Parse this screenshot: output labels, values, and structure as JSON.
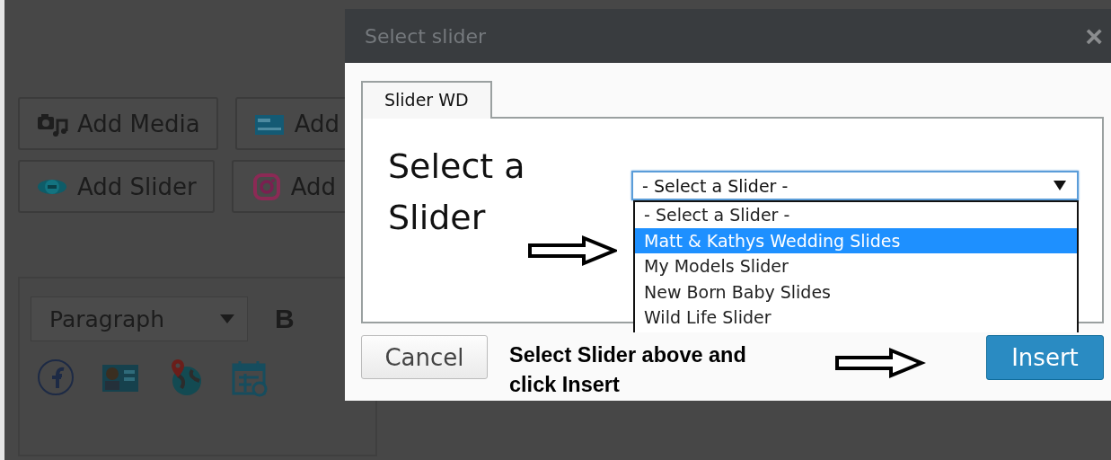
{
  "background": {
    "buttons": [
      {
        "label": "Add Media"
      },
      {
        "label": "Add"
      },
      {
        "label": "Add Slider"
      },
      {
        "label": "Add"
      }
    ],
    "editor": {
      "format": "Paragraph",
      "bold": "B"
    }
  },
  "dialog": {
    "title": "Select slider",
    "close": "×",
    "tabs": [
      {
        "label": "Slider WD",
        "selected": true
      }
    ],
    "heading": "Select a Slider",
    "select": {
      "value": "- Select a Slider -",
      "expanded": true,
      "options": [
        {
          "label": "- Select a Slider -",
          "highlighted": false
        },
        {
          "label": "Matt & Kathys Wedding Slides",
          "highlighted": true
        },
        {
          "label": "My Models Slider",
          "highlighted": false
        },
        {
          "label": "New Born Baby Slides",
          "highlighted": false
        },
        {
          "label": "Wild Life Slider",
          "highlighted": false
        }
      ]
    },
    "cancel": "Cancel",
    "instruction": "Select Slider above and click Insert",
    "insert": "Insert"
  }
}
